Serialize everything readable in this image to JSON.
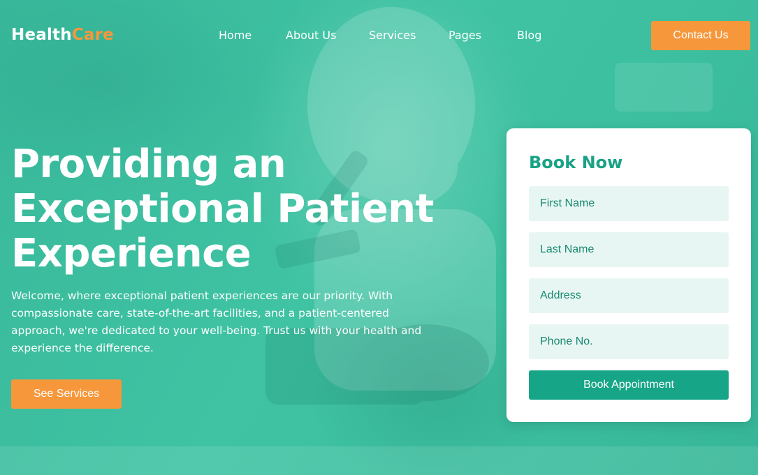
{
  "brand": {
    "logo_part1": "Health",
    "logo_part2": "Care"
  },
  "nav": {
    "items": [
      {
        "label": "Home"
      },
      {
        "label": "About Us"
      },
      {
        "label": "Services"
      },
      {
        "label": "Pages"
      },
      {
        "label": "Blog"
      }
    ],
    "contact_label": "Contact Us"
  },
  "hero": {
    "headline_lines": [
      "Providing an",
      "Exceptional Patient",
      "Experience"
    ],
    "intro": "Welcome, where exceptional patient experiences are our priority. With compassionate care, state-of-the-art facilities, and a patient-centered approach, we're dedicated to your well-being. Trust us with your health and experience the difference.",
    "cta_label": "See Services",
    "background_image": "scientist-with-microscope-photo"
  },
  "booking": {
    "title": "Book Now",
    "fields": [
      {
        "placeholder": "First Name",
        "value": ""
      },
      {
        "placeholder": "Last Name",
        "value": ""
      },
      {
        "placeholder": "Address",
        "value": ""
      },
      {
        "placeholder": "Phone No.",
        "value": ""
      }
    ],
    "submit_label": "Book Appointment"
  },
  "colors": {
    "primary_teal": "#3cbf9f",
    "accent_orange": "#f7973b",
    "button_teal": "#16a587",
    "title_teal": "#1aa286",
    "field_bg": "#e8f6f3"
  }
}
